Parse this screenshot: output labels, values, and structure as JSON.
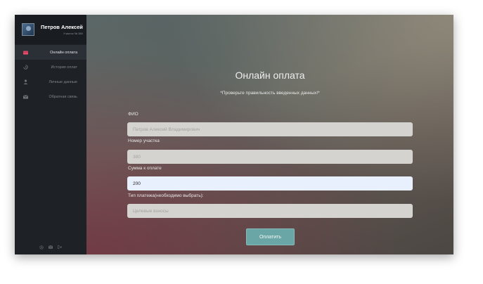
{
  "profile": {
    "name": "Петров Алексей",
    "subtitle": "Участок № 380",
    "avatar_icon": "user-photo"
  },
  "sidebar": {
    "items": [
      {
        "label": "Онлайн оплата",
        "icon": "card-icon",
        "active": true
      },
      {
        "label": "История оплат",
        "icon": "history-icon",
        "active": false
      },
      {
        "label": "Личные данные",
        "icon": "user-icon",
        "active": false
      },
      {
        "label": "Обратная связь",
        "icon": "mail-icon",
        "active": false
      }
    ],
    "footer_icons": [
      "settings-icon",
      "mail-icon",
      "logout-icon"
    ]
  },
  "main": {
    "title": "Онлайн оплата",
    "subtitle": "*Проверьте правильность введенных данных!*",
    "fields": [
      {
        "label": "ФИО",
        "value": "",
        "placeholder": "Петров Алексей Владимирович"
      },
      {
        "label": "Номер участка",
        "value": "",
        "placeholder": "380"
      },
      {
        "label": "Сумма к оплате",
        "value": "200",
        "placeholder": ""
      },
      {
        "label": "Тип платежа(необходимо выбрать):",
        "value": "",
        "placeholder": "Целевые взносы"
      }
    ],
    "pay_button": "Оплатить"
  },
  "colors": {
    "sidebar_bg": "#1e2226",
    "accent_active": "#e94b6a",
    "button": "#6aa6a5",
    "focused_field": "#e8f0fe"
  }
}
